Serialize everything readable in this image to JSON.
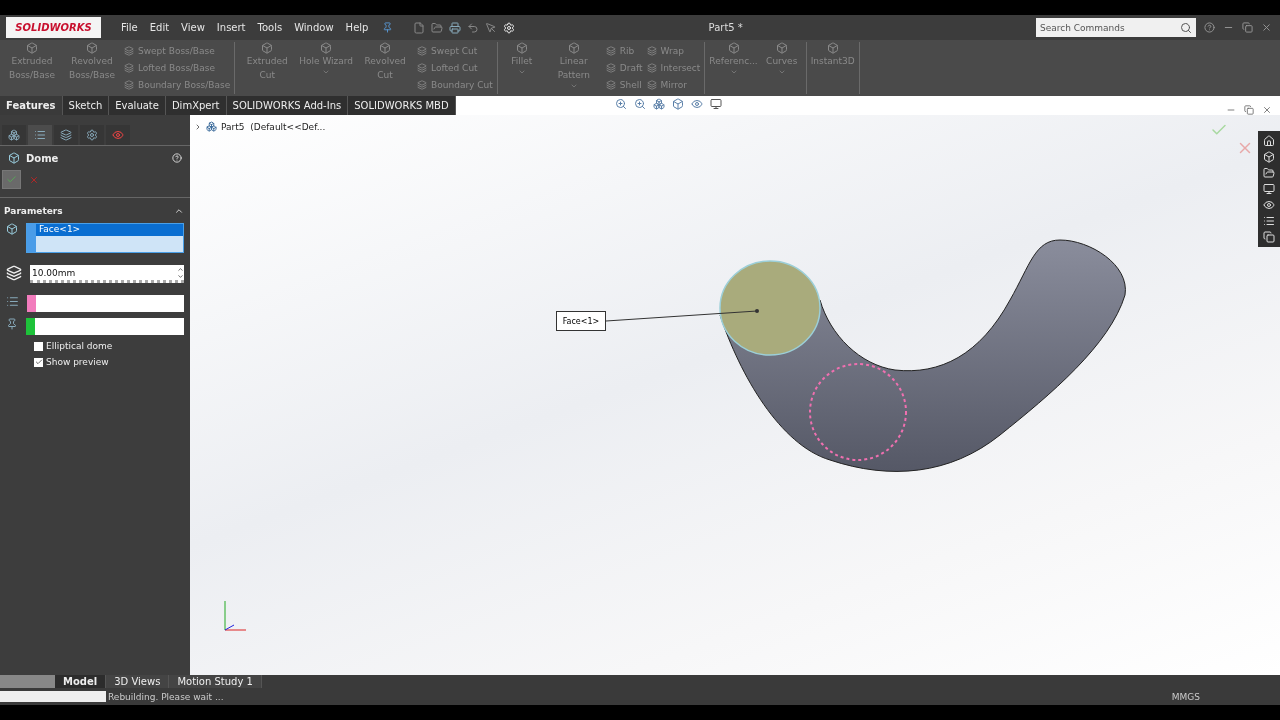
{
  "app": {
    "logo": "SOLIDWORKS",
    "menus": [
      "File",
      "Edit",
      "View",
      "Insert",
      "Tools",
      "Window",
      "Help"
    ],
    "document_title": "Part5 *",
    "search": {
      "placeholder": "Search Commands"
    }
  },
  "ribbon": {
    "groups": [
      {
        "items": [
          {
            "kind": "large",
            "label": "Extruded Boss/Base",
            "dropdown": false
          },
          {
            "kind": "large",
            "label": "Revolved Boss/Base",
            "dropdown": false
          },
          {
            "kind": "stack",
            "labels": [
              "Swept Boss/Base",
              "Lofted Boss/Base",
              "Boundary Boss/Base"
            ]
          }
        ]
      },
      {
        "items": [
          {
            "kind": "large",
            "label": "Extruded Cut",
            "dropdown": false
          },
          {
            "kind": "large",
            "label": "Hole Wizard",
            "dropdown": true
          },
          {
            "kind": "large",
            "label": "Revolved Cut",
            "dropdown": false
          },
          {
            "kind": "stack",
            "labels": [
              "Swept Cut",
              "Lofted Cut",
              "Boundary Cut"
            ]
          }
        ]
      },
      {
        "items": [
          {
            "kind": "large",
            "label": "Fillet",
            "dropdown": true
          },
          {
            "kind": "large",
            "label": "Linear Pattern",
            "dropdown": true
          },
          {
            "kind": "stack",
            "labels": [
              "Rib",
              "Draft",
              "Shell"
            ]
          },
          {
            "kind": "stack",
            "labels": [
              "Wrap",
              "Intersect",
              "Mirror"
            ]
          }
        ]
      },
      {
        "items": [
          {
            "kind": "large",
            "label": "Referenc...",
            "dropdown": true
          },
          {
            "kind": "large",
            "label": "Curves",
            "dropdown": true
          }
        ]
      },
      {
        "items": [
          {
            "kind": "large",
            "label": "Instant3D",
            "dropdown": false
          }
        ]
      }
    ]
  },
  "command_tabs": [
    {
      "label": "Features",
      "selected": true
    },
    {
      "label": "Sketch",
      "selected": false
    },
    {
      "label": "Evaluate",
      "selected": false
    },
    {
      "label": "DimXpert",
      "selected": false
    },
    {
      "label": "SOLIDWORKS Add-Ins",
      "selected": false
    },
    {
      "label": "SOLIDWORKS MBD",
      "selected": false
    }
  ],
  "property_manager": {
    "title": "Dome",
    "section": "Parameters",
    "faces": [
      "Face<1>"
    ],
    "distance": "10.00mm",
    "options": [
      {
        "label": "Elliptical dome",
        "checked": false
      },
      {
        "label": "Show preview",
        "checked": true
      }
    ]
  },
  "tree": {
    "root": "Part5  (Default<<Def..."
  },
  "viewport": {
    "callout": "Face<1>"
  },
  "bottom_tabs": [
    {
      "label": "Model",
      "selected": true
    },
    {
      "label": "3D Views",
      "selected": false
    },
    {
      "label": "Motion Study 1",
      "selected": false
    }
  ],
  "status_bar": {
    "progress": {
      "level": 0
    },
    "message": "Rebuilding. Please wait ...",
    "units": "MMGS"
  }
}
